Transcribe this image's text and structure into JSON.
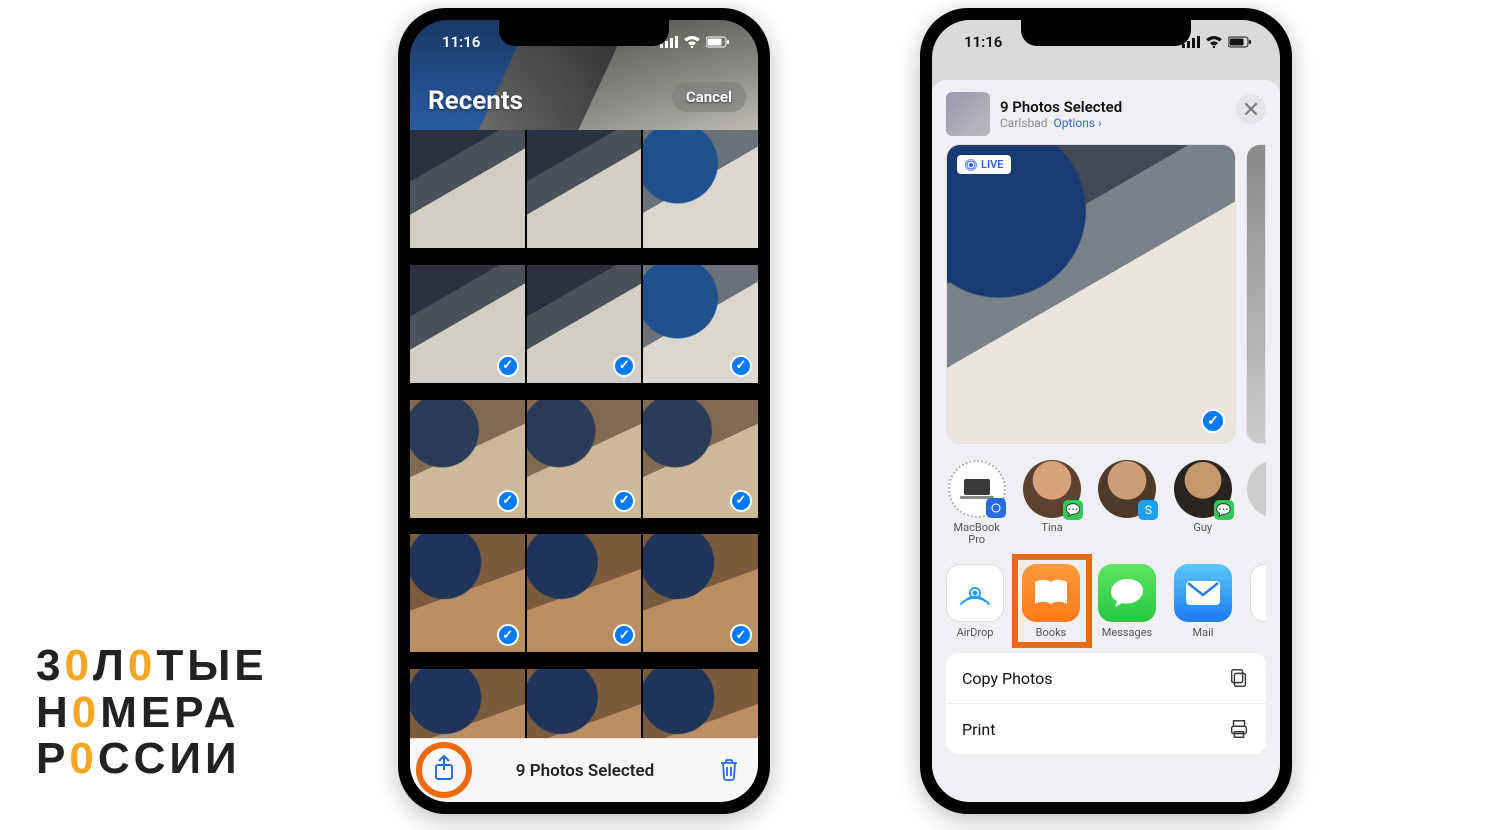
{
  "logo": {
    "line1": "30Л0ТЫЕ",
    "line2": "Н0МЕРА",
    "line3": "Р0ССИИ"
  },
  "status": {
    "time": "11:16"
  },
  "left": {
    "album_title": "Recents",
    "cancel": "Cancel",
    "selected_label": "9 Photos Selected"
  },
  "right": {
    "header_title": "9 Photos Selected",
    "location": "Carlsbad",
    "options": "Options",
    "live": "LIVE",
    "contacts": [
      {
        "name": "MacBook\nPro",
        "type": "device"
      },
      {
        "name": "Tina",
        "type": "person",
        "corner": "green"
      },
      {
        "name": " ",
        "type": "person",
        "corner": "blue"
      },
      {
        "name": "Guy",
        "type": "person",
        "corner": "green"
      }
    ],
    "apps": {
      "airdrop": "AirDrop",
      "books": "Books",
      "messages": "Messages",
      "mail": "Mail"
    },
    "actions": {
      "copy": "Copy Photos",
      "print": "Print"
    }
  }
}
